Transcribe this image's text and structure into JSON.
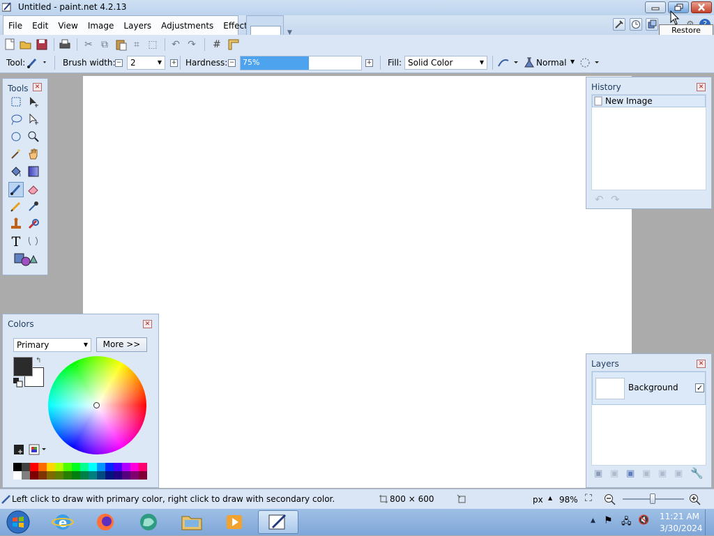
{
  "window": {
    "title": "Untitled - paint.net 4.2.13"
  },
  "tooltip": "Restore Down",
  "menu": {
    "items": [
      "File",
      "Edit",
      "View",
      "Image",
      "Layers",
      "Adjustments",
      "Effects"
    ]
  },
  "toolbar": {
    "tool_label": "Tool:",
    "brush_width_label": "Brush width:",
    "brush_width_value": "2",
    "hardness_label": "Hardness:",
    "hardness_value": "75%",
    "hardness_level": 0.75,
    "fill_label": "Fill:",
    "fill_value": "Solid Color",
    "blend_mode": "Normal"
  },
  "panels": {
    "tools": {
      "title": "Tools"
    },
    "history": {
      "title": "History",
      "items": [
        "New Image"
      ]
    },
    "colors": {
      "title": "Colors",
      "mode": "Primary",
      "more_button": "More >>",
      "primary_color": "#2b2b2b",
      "secondary_color": "#ffffff"
    },
    "layers": {
      "title": "Layers",
      "items": [
        {
          "name": "Background",
          "visible": true
        }
      ]
    }
  },
  "status": {
    "hint": "Left click to draw with primary color, right click to draw with secondary color.",
    "image_size": "800 × 600",
    "unit": "px",
    "zoom": "98%"
  },
  "taskbar": {
    "time": "11:21 AM",
    "date": "3/30/2024"
  },
  "palette": [
    "#000000",
    "#404040",
    "#ff0000",
    "#ff6a00",
    "#ffd800",
    "#b6ff00",
    "#4cff00",
    "#00ff21",
    "#00ff90",
    "#00ffff",
    "#0094ff",
    "#0026ff",
    "#4800ff",
    "#b200ff",
    "#ff00dc",
    "#ff006e"
  ],
  "palette_dark": [
    "#ffffff",
    "#808080",
    "#7f0000",
    "#7f3300",
    "#7f6a00",
    "#5b7f00",
    "#267f00",
    "#007f0e",
    "#007f46",
    "#007f7f",
    "#004a7f",
    "#00137f",
    "#21007f",
    "#57007f",
    "#7f006e",
    "#7f0037"
  ]
}
